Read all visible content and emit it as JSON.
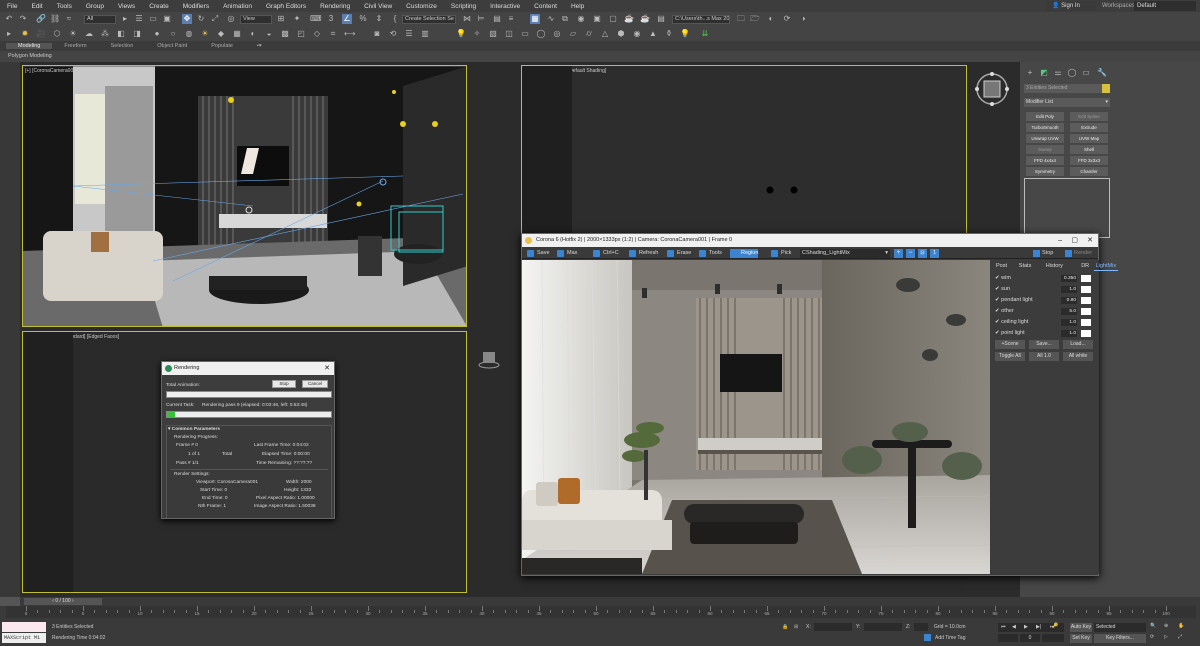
{
  "menu": [
    "File",
    "Edit",
    "Tools",
    "Group",
    "Views",
    "Create",
    "Modifiers",
    "Animation",
    "Graph Editors",
    "Rendering",
    "Civil View",
    "Customize",
    "Scripting",
    "Interactive",
    "Content",
    "Help"
  ],
  "account": {
    "sign_in": "Sign In",
    "workspaces_label": "Workspaces:",
    "workspace": "Default"
  },
  "toolbar": {
    "selection_filter": "All",
    "reference_coord": "View",
    "named_selection": "Create Selection Se",
    "project_path": "C:\\Users\\th...s Max 2020"
  },
  "ribbon": {
    "tabs": [
      "Modeling",
      "Freeform",
      "Selection",
      "Object Paint",
      "Populate"
    ],
    "active_tab": "Modeling",
    "sub_label": "Polygon Modeling"
  },
  "viewports": {
    "camera_label": "[+] [CoronaCamera001] [Standard] [Default Shading]",
    "top_label": "[+] [Top] [Standard] [Default Shading]",
    "persp_label": "[+] [Perspective] [Standard] [Edged Faces]"
  },
  "command_panel": {
    "object_name": "3 Entities Selected",
    "modifier_list": "Modifier List",
    "buttons": [
      "Edit Poly",
      "Edit Spline",
      "TurboSmooth",
      "Extrude",
      "Unwrap UVW",
      "UVW Map",
      "Sweep",
      "Shell",
      "FFD 4x4x4",
      "FFD 3x3x3",
      "Symmetry",
      "Chamfer"
    ]
  },
  "corona": {
    "title": "Corona 6 (Hotfix 2) | 2000×1333px (1:2) | Camera: CoronaCamera001 | Frame 0",
    "toolbar": [
      "Save",
      "Max",
      "Ctrl+C",
      "Refresh",
      "Erase",
      "Tools",
      "Region",
      "Pick"
    ],
    "channel": "CShading_LightMix",
    "stop": "Stop",
    "render_btn": "Render",
    "tabs": [
      "Post",
      "Stats",
      "History",
      "DR",
      "LightMix"
    ],
    "active_tab": "LightMix",
    "lights": [
      {
        "name": "wim",
        "value": "0.350"
      },
      {
        "name": "sun",
        "value": "1.0"
      },
      {
        "name": "pendant light",
        "value": "0.80"
      },
      {
        "name": "other",
        "value": "5.0"
      },
      {
        "name": "ceiling light",
        "value": "1.0"
      },
      {
        "name": "point light",
        "value": "1.0"
      }
    ],
    "buttons": [
      "+Scene",
      "Save...",
      "Load...",
      "Toggle All",
      "All 1.0",
      "All white"
    ]
  },
  "render_dialog": {
    "title": "Rendering",
    "total_animation": "Total Animation:",
    "stop": "Stop",
    "cancel": "Cancel",
    "current_task": "Current Task:",
    "current_task_value": "Rendering pass 9 (elapsed: 0:03:46, left: 0:53:48)",
    "section": "Common Parameters",
    "progress_label": "Rendering Progress:",
    "frame_label": "Frame #",
    "frame_value": "0",
    "of_label": "1 of 1",
    "total_label": "Total",
    "pass_label": "Pass #",
    "pass_value": "1/1",
    "last_frame_time": "Last Frame Time: 0:04:02",
    "elapsed_time": "Elapsed Time: 0:00:00",
    "time_remaining": "Time Remaining: ??:??:??",
    "settings_label": "Render Settings:",
    "viewport": "Viewport: CoronaCamera001",
    "width": "Width: 2000",
    "start_time": "Start Time: 0",
    "height": "Height: 1333",
    "end_time": "End Time: 0",
    "pixel_aspect": "Pixel Aspect Ratio: 1.00000",
    "nth_frame": "Nth Frame: 1",
    "image_aspect": "Image Aspect Ratio: 1.50038",
    "total_progress": 0,
    "task_progress": 0.05
  },
  "timeline": {
    "frame_counter": "0 / 100",
    "ticks": [
      "0",
      "5",
      "10",
      "15",
      "20",
      "25",
      "30",
      "35",
      "40",
      "45",
      "50",
      "55",
      "60",
      "65",
      "70",
      "75",
      "80",
      "85",
      "90",
      "95",
      "100"
    ]
  },
  "status": {
    "maxscript": "MAXScript Mi",
    "selected": "3 Entities Selected",
    "render_time": "Rendering Time 0:04:02",
    "x_label": "X:",
    "y_label": "Y:",
    "z_label": "Z:",
    "grid": "Grid = 10.0cm",
    "add_time_tag": "Add Time Tag",
    "auto_key": "Auto Key",
    "selected_drop": "Selected",
    "set_key": "Set Key",
    "key_filters": "Key Filters...",
    "frame": "0"
  },
  "colors": {
    "viewport_border": "#bfbf2f",
    "accent_blue": "#3d84d0",
    "progress_green": "#38c038"
  }
}
